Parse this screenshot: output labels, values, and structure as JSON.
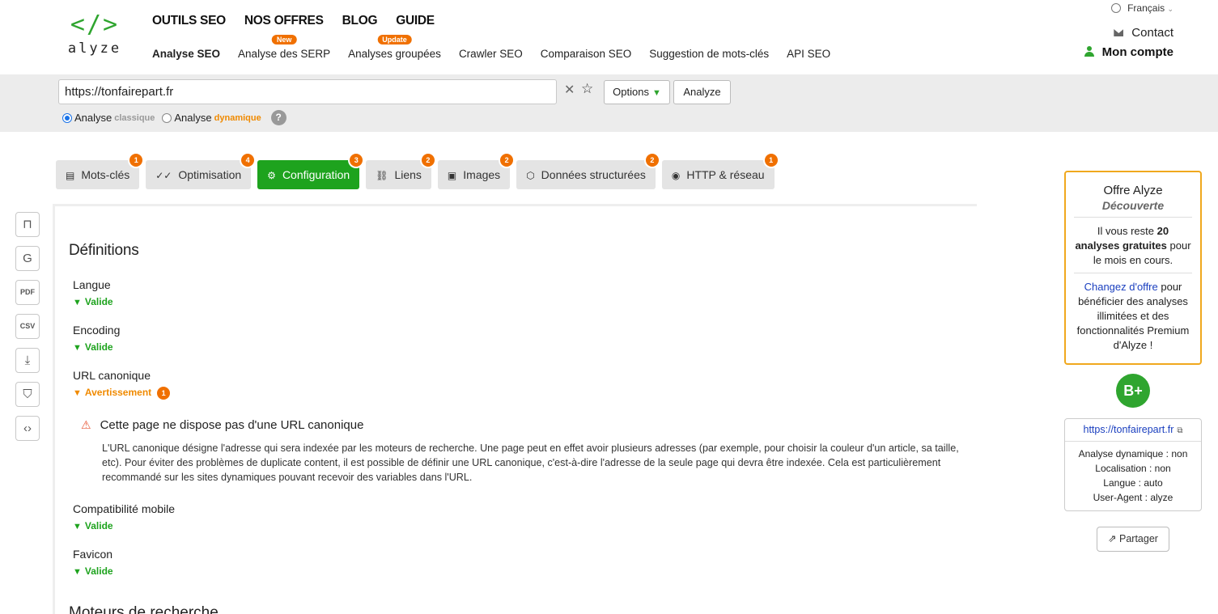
{
  "logo": {
    "mark": "</>",
    "text": "alyze"
  },
  "main_nav": [
    "OUTILS SEO",
    "NOS OFFRES",
    "BLOG",
    "GUIDE"
  ],
  "sub_nav": [
    {
      "label": "Analyse SEO",
      "badge": ""
    },
    {
      "label": "Analyse des SERP",
      "badge": "New"
    },
    {
      "label": "Analyses groupées",
      "badge": "Update"
    },
    {
      "label": "Crawler SEO",
      "badge": ""
    },
    {
      "label": "Comparaison SEO",
      "badge": ""
    },
    {
      "label": "Suggestion de mots-clés",
      "badge": ""
    },
    {
      "label": "API SEO",
      "badge": ""
    }
  ],
  "header": {
    "language": "Français",
    "contact": "Contact",
    "account": "Mon compte"
  },
  "search": {
    "url": "https://tonfairepart.fr",
    "options_label": "Options",
    "analyze_label": "Analyze",
    "mode_label": "Analyse",
    "mode_classic": "classique",
    "mode_dynamic": "dynamique",
    "help": "?"
  },
  "tabs": [
    {
      "label": "Mots-clés",
      "count": "1",
      "icon": "message-icon"
    },
    {
      "label": "Optimisation",
      "count": "4",
      "icon": "trend-icon"
    },
    {
      "label": "Configuration",
      "count": "3",
      "icon": "gear-icon"
    },
    {
      "label": "Liens",
      "count": "2",
      "icon": "link-icon"
    },
    {
      "label": "Images",
      "count": "2",
      "icon": "image-icon"
    },
    {
      "label": "Données structurées",
      "count": "2",
      "icon": "cube-icon"
    },
    {
      "label": "HTTP & réseau",
      "count": "1",
      "icon": "globe-icon"
    }
  ],
  "tools": [
    "glass-icon",
    "google-icon",
    "PDF",
    "CSV",
    "download-icon",
    "bookmark-icon",
    "code-icon"
  ],
  "content": {
    "section_title": "Définitions",
    "items": [
      {
        "label": "Langue",
        "status": "Valide"
      },
      {
        "label": "Encoding",
        "status": "Valide"
      },
      {
        "label": "URL canonique",
        "status": "Avertissement",
        "warn_count": "1"
      },
      {
        "label": "Compatibilité mobile",
        "status": "Valide"
      },
      {
        "label": "Favicon",
        "status": "Valide"
      }
    ],
    "issue_title": "Cette page ne dispose pas d'une URL canonique",
    "issue_desc": "L'URL canonique désigne l'adresse qui sera indexée par les moteurs de recherche. Une page peut en effet avoir plusieurs adresses (par exemple, pour choisir la couleur d'un article, sa taille, etc). Pour éviter des problèmes de duplicate content, il est possible de définir une URL canonique, c'est-à-dire l'adresse de la seule page qui devra être indexée. Cela est particulièrement recommandé sur les sites dynamiques pouvant recevoir des variables dans l'URL.",
    "section_title2": "Moteurs de recherche"
  },
  "offer": {
    "title": "Offre Alyze",
    "plan": "Découverte",
    "remaining_prefix": "Il vous reste",
    "remaining_bold": "20 analyses gratuites",
    "remaining_suffix": "pour le mois en cours.",
    "link": "Changez d'offre",
    "link_suffix": "pour bénéficier des analyses illimitées et des fonctionnalités Premium d'Alyze !"
  },
  "grade": "B+",
  "site": {
    "url": "https://tonfairepart.fr",
    "meta": [
      "Analyse dynamique : non",
      "Localisation : non",
      "Langue : auto",
      "User-Agent : alyze"
    ]
  },
  "share_label": "Partager"
}
